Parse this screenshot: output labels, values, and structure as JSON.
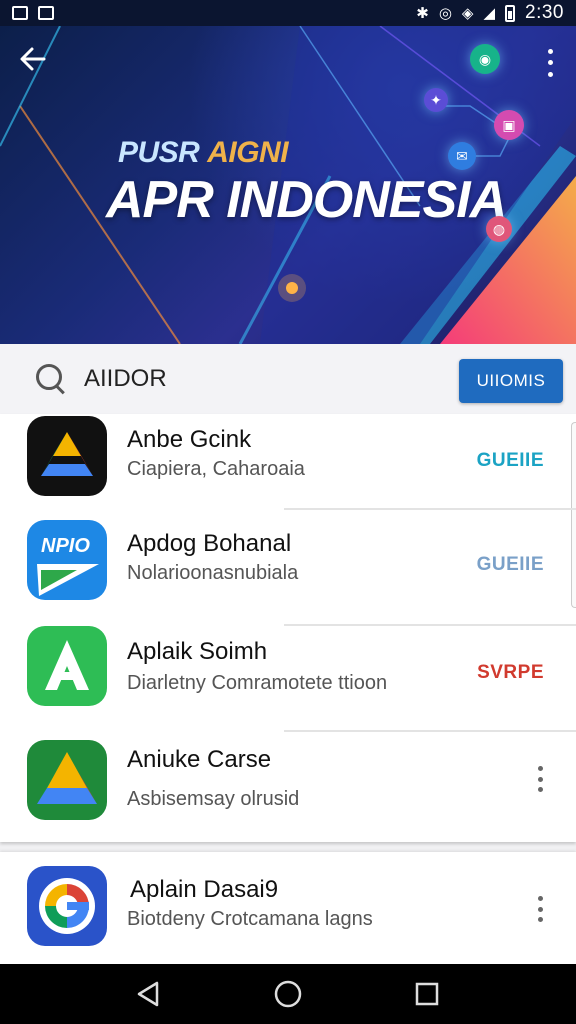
{
  "status_bar": {
    "time": "2:30"
  },
  "banner": {
    "subtitle_a": "PUSR",
    "subtitle_b": "AIGNI",
    "title": "APR INDONESIA"
  },
  "search": {
    "value": "AIIDOR",
    "button_label": "UIIOMIS"
  },
  "apps": [
    {
      "name": "Anbe Gcink",
      "desc": "Ciapiera, Caharoaia",
      "action": "GUEIIE",
      "action_color": "#1ba3c4",
      "icon": "drive-dark-icon"
    },
    {
      "name": "Apdog Bohanal",
      "desc": "Nolarioonasnubiala",
      "action": "GUEIIE",
      "action_color": "#7aa0c8",
      "icon": "npio-app-icon"
    },
    {
      "name": "Aplaik Soimh",
      "desc": "Diarletny Comramotete ttioon",
      "action": "SVRPE",
      "action_color": "#d13a2e",
      "icon": "green-a-app-icon"
    },
    {
      "name": "Aniuke Carse",
      "desc": "Asbisemsay olrusid",
      "icon": "drive-green-icon"
    },
    {
      "name": "Aplain Dasai9",
      "desc": "Biotdeny Crotcamana lagns",
      "icon": "google-blue-icon"
    }
  ],
  "colors": {
    "accent": "#1f6bbf",
    "banner_dark": "#0c1f4a"
  }
}
